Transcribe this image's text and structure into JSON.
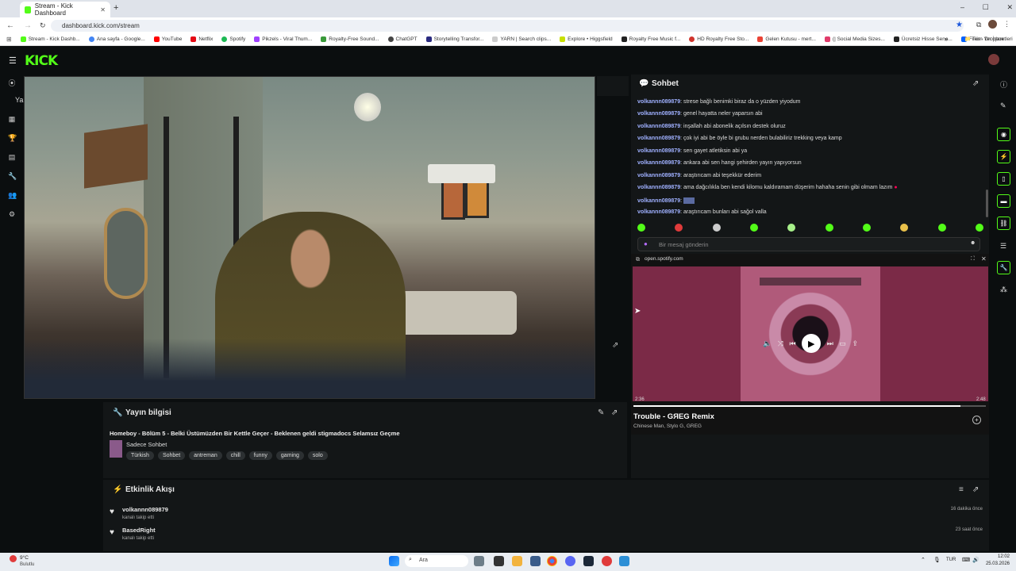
{
  "browser": {
    "tab_title": "Stream - Kick Dashboard",
    "url": "dashboard.kick.com/stream",
    "bookmarks": [
      "Stream - Kick Dashb...",
      "Ana sayfa - Google...",
      "YouTube",
      "Netflix",
      "Spotify",
      "Pikzels - Viral Thum...",
      "Royalty-Free Sound...",
      "ChatGPT",
      "Storytelling Transfor...",
      "YARN | Search clips...",
      "Explore • Higgsfield",
      "Royalty Free Music f...",
      "HD Royalty Free Sto...",
      "Gelen Kutusu - mert...",
      "(| Social Media Sizes...",
      "Ücretsiz Hisse Sene...",
      "Files - Dropbox"
    ],
    "all_bookmarks": "Tüm Yer İşaretleri"
  },
  "chat": {
    "title": "Sohbet",
    "placeholder": "Bir mesaj gönderin",
    "messages": [
      {
        "user": "volkannn089879",
        "text": "strese bağlı benimki biraz da o yüzden yiyodum"
      },
      {
        "user": "volkannn089879",
        "text": "genel hayatta neler yaparsın abi"
      },
      {
        "user": "volkannn089879",
        "text": "inşallah abi abonelik açılsın destek oluruz"
      },
      {
        "user": "volkannn089879",
        "text": "çok iyi abi be öyle bi grubu nerden bulabiliriz trekking veya kamp"
      },
      {
        "user": "volkannn089879",
        "text": "sen gayet atletiksin abi ya"
      },
      {
        "user": "volkannn089879",
        "text": "ankara abi sen hangi şehirden yayın yapıyorsun"
      },
      {
        "user": "volkannn089879",
        "text": "araştırıcam abi teşekkür ederim"
      },
      {
        "user": "volkannn089879",
        "text": "ama dağcılıkla ben kendi kilomu kaldıramam düşerim hahaha senin gibi olmam lazım"
      },
      {
        "user": "volkannn089879",
        "text": ""
      },
      {
        "user": "volkannn089879",
        "text": "araştırıcam bunları abi sağol valla"
      }
    ]
  },
  "spotify": {
    "domain": "open.spotify.com",
    "elapsed": "2:36",
    "duration": "2:48",
    "progress": 0.929,
    "track": "Trouble - GЯEG Remix",
    "artists": "Chinese Man, Stylo G, GREG"
  },
  "stream_info": {
    "title": "Yayın bilgisi",
    "stream_title": "Homeboy - Bölüm 5 - Belki Üstümüzden Bir Kettle Geçer - Beklenen geldi stigmadocs Selamsız Geçme",
    "category": "Sadece Sohbet",
    "tags": [
      "Türkish",
      "Sohbet",
      "antreman",
      "chill",
      "funny",
      "gaming",
      "solo"
    ]
  },
  "activity": {
    "title": "Etkinlik Akışı",
    "events": [
      {
        "user": "volkannn089879",
        "action": "kanalı takip etti",
        "time": "16 dakika önce"
      },
      {
        "user": "BasedRight",
        "action": "kanalı takip etti",
        "time": "23 saat önce"
      }
    ]
  },
  "sidebar": {
    "section": "Ya"
  },
  "taskbar": {
    "weather_temp": "9°C",
    "weather_desc": "Bulutlu",
    "search": "Ara",
    "lang": "TUR",
    "time": "12:02",
    "date": "25.03.2026"
  },
  "colors": {
    "accent": "#53fc18",
    "chat_user": "#9fb0ff",
    "spotify_bg": "#7b2a47"
  }
}
